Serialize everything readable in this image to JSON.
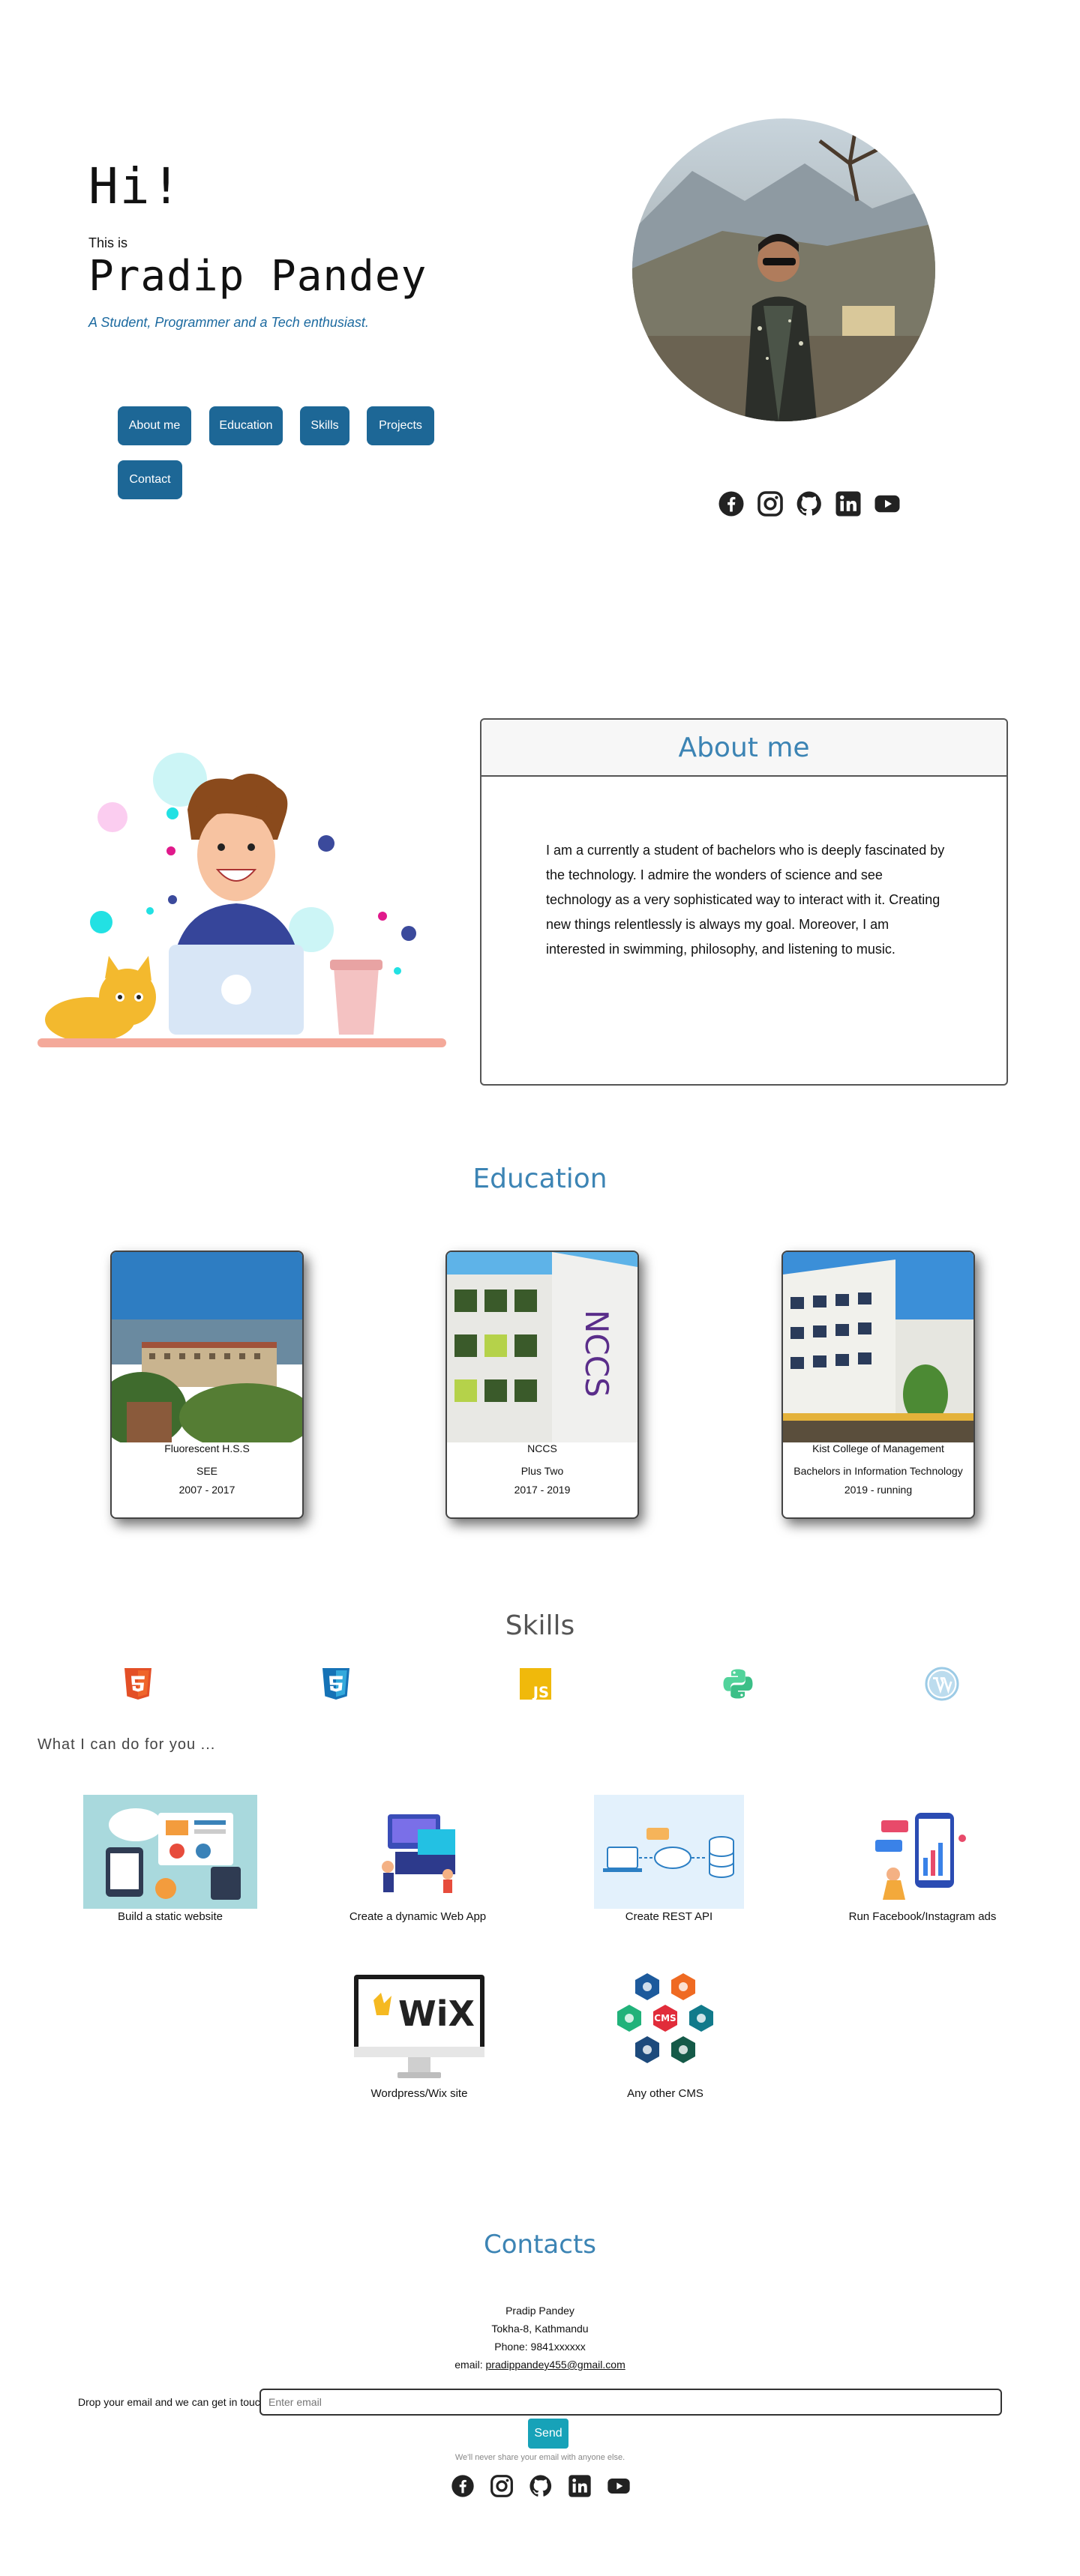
{
  "hero": {
    "greeting": "Hi!",
    "intro": "This is",
    "name": "Pradip Pandey",
    "tagline": "A Student, Programmer and a Tech enthusiast."
  },
  "nav": [
    {
      "label": "About me"
    },
    {
      "label": "Education"
    },
    {
      "label": "Skills"
    },
    {
      "label": "Projects"
    },
    {
      "label": "Contact"
    }
  ],
  "social_icons": [
    "facebook-icon",
    "instagram-icon",
    "github-icon",
    "linkedin-icon",
    "youtube-icon"
  ],
  "about": {
    "title": "About me",
    "text": "I am a currently a student of bachelors who is deeply fascinated by the technology. I admire the wonders of science and see technology as a very sophisticated way to interact with it. Creating new things relentlessly is always my goal. Moreover, I am interested in swimming, philosophy, and listening to music."
  },
  "education": {
    "title": "Education",
    "items": [
      {
        "school": "Fluorescent H.S.S",
        "level": "SEE",
        "years": "2007 - 2017"
      },
      {
        "school": "NCCS",
        "level": "Plus Two",
        "years": "2017 - 2019"
      },
      {
        "school": "Kist College of Management",
        "level": "Bachelors in Information Technology",
        "years": "2019 - running"
      }
    ]
  },
  "skills": {
    "title": "Skills",
    "icons": [
      "html5-icon",
      "css3-icon",
      "js-icon",
      "python-icon",
      "wordpress-icon"
    ],
    "js_label": "JS",
    "offer_title": "What I can do for you ...",
    "offers": [
      {
        "label": "Build a static website"
      },
      {
        "label": "Create a dynamic Web App"
      },
      {
        "label": "Create REST API"
      },
      {
        "label": "Run Facebook/Instagram ads"
      },
      {
        "label": "Wordpress/Wix site"
      },
      {
        "label": "Any other CMS"
      }
    ],
    "wix_text": "WiX",
    "cms_text": "CMS"
  },
  "contact": {
    "title": "Contacts",
    "name": "Pradip Pandey",
    "address": "Tokha-8, Kathmandu",
    "phone": "Phone: 9841xxxxxx",
    "email_label": "email:",
    "email": "pradippandey455@gmail.com",
    "form_label": "Drop your email and we can get in touch!",
    "form_placeholder": "Enter email",
    "send_label": "Send",
    "note": "We'll never share your email with anyone else."
  },
  "colors": {
    "nav_button": "#1d6796",
    "section_title": "#3c84b4",
    "tagline": "#1c6aa0",
    "send_button": "#17a2b8"
  }
}
